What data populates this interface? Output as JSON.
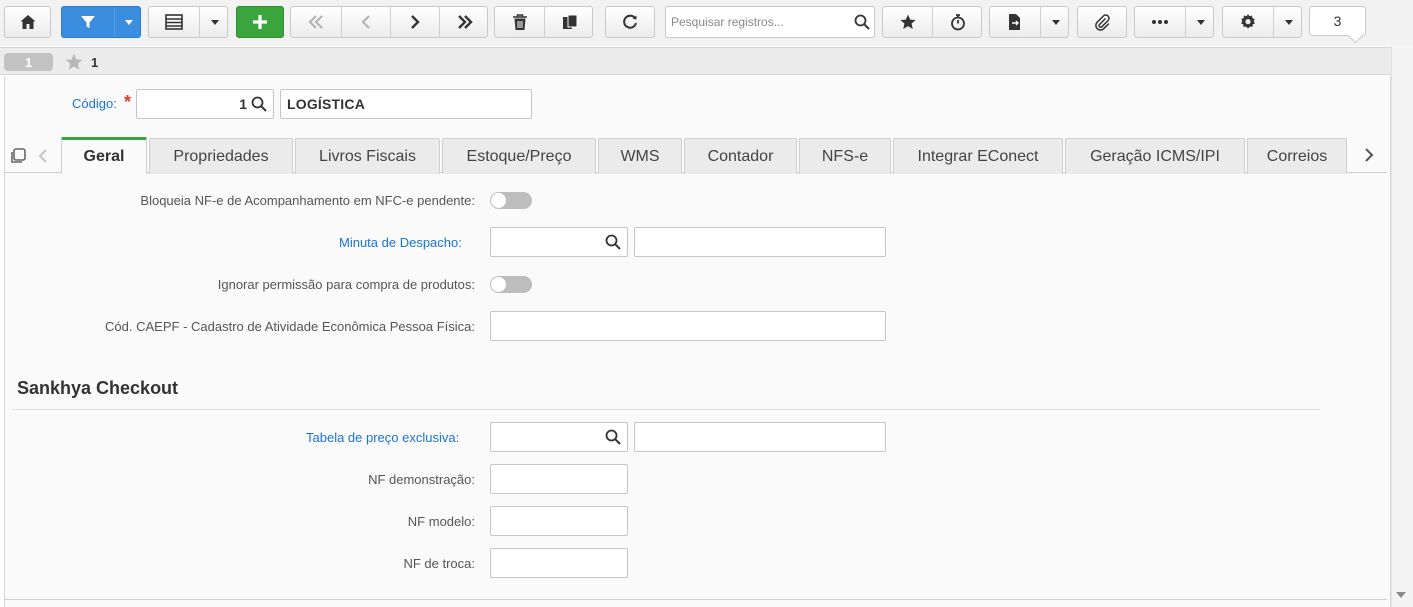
{
  "toolbar": {
    "search_placeholder": "Pesquisar registros...",
    "record_count": "3"
  },
  "record_strip": {
    "pill": "1",
    "star_number": "1"
  },
  "form": {
    "codigo_label": "Código:",
    "codigo_value": "1",
    "codigo_desc": "LOGÍSTICA"
  },
  "tabs": [
    {
      "label": "Geral",
      "active": true
    },
    {
      "label": "Propriedades"
    },
    {
      "label": "Livros Fiscais"
    },
    {
      "label": "Estoque/Preço"
    },
    {
      "label": "WMS"
    },
    {
      "label": "Contador"
    },
    {
      "label": "NFS-e"
    },
    {
      "label": "Integrar EConect"
    },
    {
      "label": "Geração ICMS/IPI"
    },
    {
      "label": "Correios"
    }
  ],
  "fields": {
    "bloqueia_label": "Bloqueia NF-e de Acompanhamento em NFC-e pendente:",
    "minuta_label": "Minuta de Despacho:",
    "ignorar_label": "Ignorar permissão para compra de produtos:",
    "caepf_label": "Cód. CAEPF - Cadastro de Atividade Econômica Pessoa Física:",
    "section_title": "Sankhya Checkout",
    "tabela_label": "Tabela de preço exclusiva:",
    "nf_demo_label": "NF demonstração:",
    "nf_modelo_label": "NF modelo:",
    "nf_troca_label": "NF de troca:"
  },
  "colors": {
    "accent_blue": "#3b8de0",
    "accent_green": "#3aa53c",
    "link_blue": "#1a73d9",
    "required_red": "#e23a2e"
  }
}
